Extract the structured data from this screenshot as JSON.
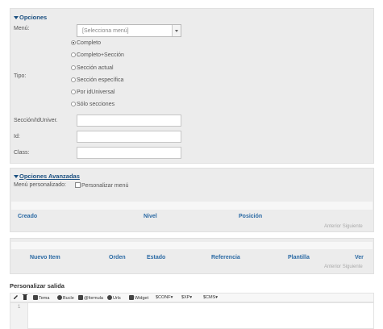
{
  "options": {
    "title": "Opciones",
    "menu_label": "Menú:",
    "menu_select_value": "[Selecciona menú]",
    "tipo_label": "Tipo:",
    "tipo_options": [
      "Completo",
      "Completo+Sección",
      "Sección actual",
      "Sección específica",
      "Por idUniversal",
      "Sólo secciones"
    ],
    "tipo_selected": "Completo",
    "seccion_label": "Sección/IdUniver.",
    "id_label": "Id:",
    "class_label": "Class:"
  },
  "advanced": {
    "title": "Opciones Avanzadas",
    "custom_menu_label": "Menú personalizado:",
    "custom_menu_checkbox_label": "Personalizar menú"
  },
  "table1": {
    "headers": [
      "Creado",
      "Nivel",
      "Posición"
    ],
    "pager_prev": "Anterior",
    "pager_next": "Siguiente"
  },
  "table2": {
    "headers": [
      "Nuevo Item",
      "Orden",
      "Estado",
      "Referencia",
      "Plantilla",
      "Ver"
    ],
    "pager_prev": "Anterior",
    "pager_next": "Siguiente"
  },
  "output": {
    "title": "Personalizar salida",
    "toolbar": [
      "Tema",
      "Bucle",
      "@formula",
      "Urls",
      "Widget",
      "$CONF",
      "$XP",
      "$CMS"
    ],
    "line_number": "1"
  }
}
